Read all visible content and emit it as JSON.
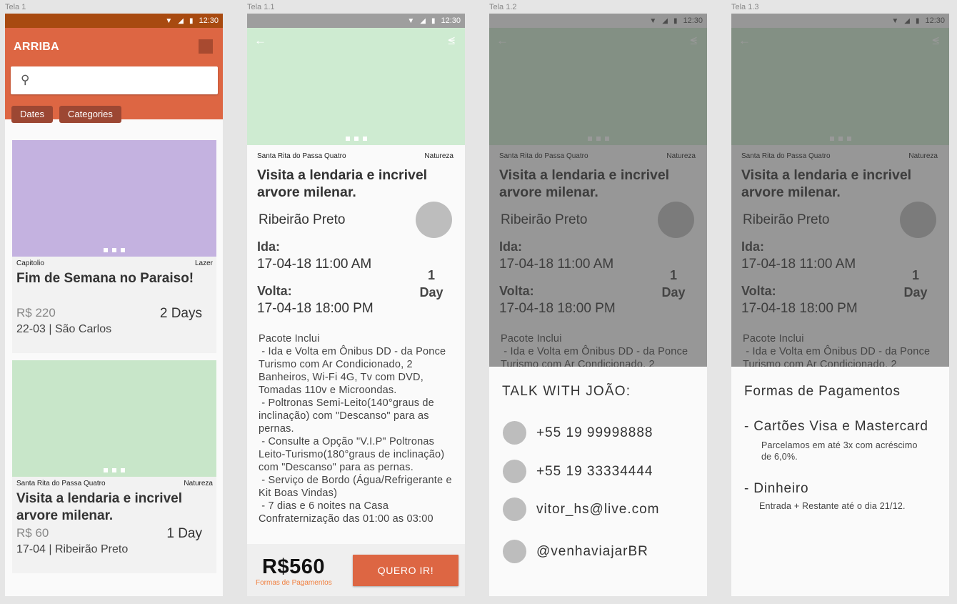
{
  "labels": {
    "s1": "Tela 1",
    "s2": "Tela 1.1",
    "s3": "Tela 1.2",
    "s4": "Tela 1.3"
  },
  "status": {
    "time": "12:30",
    "icons": [
      "wifi-icon",
      "signal-icon",
      "battery-icon"
    ]
  },
  "home": {
    "title": "ARRIBA",
    "search_placeholder": "",
    "chips": [
      "Dates",
      "Categories"
    ],
    "cards": [
      {
        "place": "Capitolio",
        "category": "Lazer",
        "title": "Fim de Semana no Paraiso!",
        "price": "R$ 220",
        "days": "2 Days",
        "sub": "22-03 | São Carlos",
        "color": "#c4b2e0"
      },
      {
        "place": "Santa Rita do Passa Quatro",
        "category": "Natureza",
        "title": "Visita a lendaria e incrivel arvore milenar.",
        "price": "R$ 60",
        "days": "1 Day",
        "sub": "17-04 | Ribeirão Preto",
        "color": "#c8e6c9"
      }
    ]
  },
  "detail": {
    "place": "Santa Rita do Passa Quatro",
    "category": "Natureza",
    "title": "Visita a lendaria e incrivel arvore milenar.",
    "city": "Ribeirão Preto",
    "ida_label": "Ida:",
    "ida_value": "17-04-18  11:00 AM",
    "volta_label": "Volta:",
    "volta_value": "17-04-18  18:00 PM",
    "duration_num": "1",
    "duration_unit": "Day",
    "pacote": "Pacote Inclui\n - Ida e Volta em Ônibus DD - da Ponce Turismo com Ar Condicionado, 2 Banheiros, Wi-Fi 4G, Tv com DVD, Tomadas 110v e Microondas.\n - Poltronas Semi-Leito(140°graus de inclinação) com \"Descanso\" para as pernas.\n - Consulte a Opção \"V.I.P\" Poltronas Leito-Turismo(180°graus de inclinação) com \"Descanso\" para as pernas.\n - Serviço de Bordo (Água/Refrigerante e Kit Boas Vindas)\n - 7 dias e 6 noites na Casa Confraternização das 01:00 as 03:00",
    "price": "R$560",
    "payment_link": "Formas de Pagamentos",
    "cta": "QUERO IR!"
  },
  "contact": {
    "title": "TALK WITH JOÃO:",
    "items": [
      "+55 19 99998888",
      "+55 19 33334444",
      "vitor_hs@live.com",
      "@venhaviajarBR"
    ]
  },
  "payment": {
    "title": "Formas de Pagamentos",
    "cards_title": "- Cartões Visa e Mastercard",
    "cards_desc": "Parcelamos em até 3x com acréscimo de 6,0%.",
    "cash_title": "- Dinheiro",
    "cash_desc": "Entrada + Restante até o dia 21/12."
  }
}
